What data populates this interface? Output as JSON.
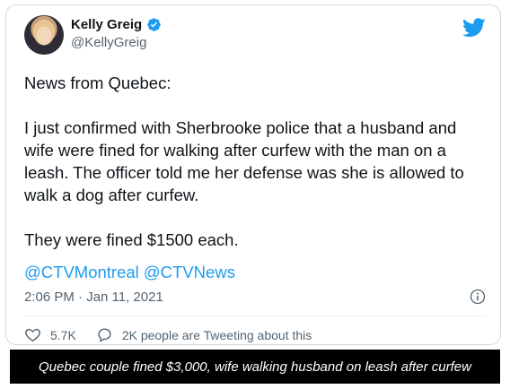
{
  "tweet": {
    "author_name": "Kelly Greig",
    "author_handle": "@KellyGreig",
    "text_paragraphs": [
      "News from Quebec:",
      "I just confirmed with Sherbrooke police that a husband and wife were fined for walking after curfew with the man on a leash. The officer told me her defense was she is allowed to walk a dog after curfew.",
      "They were fined $1500 each."
    ],
    "mentions": [
      "@CTVMontreal",
      "@CTVNews"
    ],
    "timestamp": "2:06 PM · Jan 11, 2021",
    "likes_count": "5.7K",
    "reply_text": "2K people are Tweeting about this"
  },
  "caption": {
    "text": "Quebec couple fined $3,000, wife walking husband on leash after curfew"
  },
  "icons": {
    "verified": "verified-badge-icon",
    "platform": "twitter-bird-icon",
    "info": "info-icon",
    "like": "heart-icon",
    "reply": "speech-bubble-icon"
  },
  "colors": {
    "accent": "#1d9bf0",
    "text": "#0f1419",
    "secondary": "#536471",
    "caption_bg": "#000000"
  }
}
